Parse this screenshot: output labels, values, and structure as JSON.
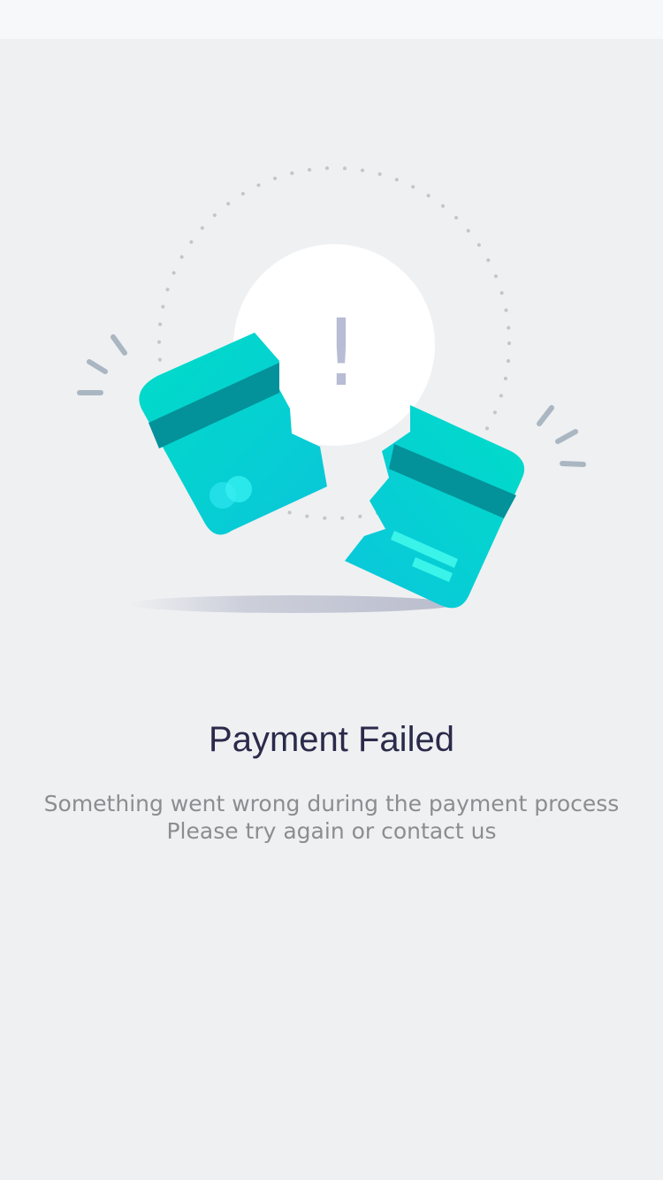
{
  "status": {
    "title": "Payment Failed",
    "message_lines": [
      "Something went wrong during the payment process",
      "Please try again or contact us"
    ],
    "exclamation": "!"
  },
  "illustration": {
    "icon": "broken-card-icon",
    "colors": {
      "card_primary": "#00d4c8",
      "card_secondary": "#0cc8da",
      "stripe": "#03919a",
      "alert_circle": "#ffffff",
      "alert_mark": "#b5bbd4",
      "motion_lines": "#a9b6c2",
      "shadow": "#c9ccd8"
    }
  }
}
